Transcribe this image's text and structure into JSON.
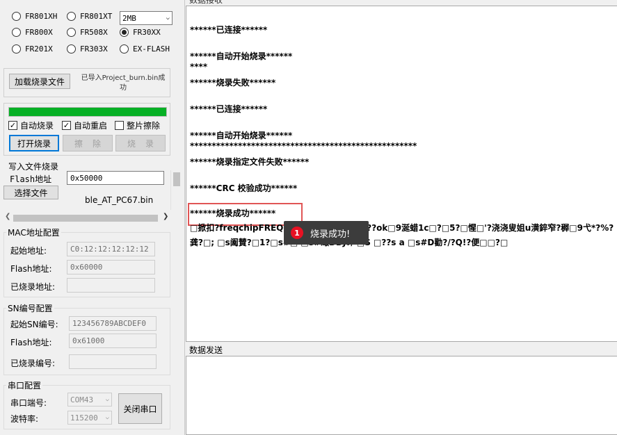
{
  "chip": {
    "options": [
      {
        "label": "FR801XH",
        "checked": false
      },
      {
        "label": "FR801XT",
        "checked": false
      },
      {
        "label": "FR800X",
        "checked": false
      },
      {
        "label": "FR508X",
        "checked": false
      },
      {
        "label": "FR30XX",
        "checked": true
      },
      {
        "label": "FR201X",
        "checked": false
      },
      {
        "label": "FR303X",
        "checked": false
      },
      {
        "label": "EX-FLASH",
        "checked": false
      }
    ],
    "flash_size": "2MB"
  },
  "load": {
    "button": "加载烧录文件",
    "status": "已导入Project_burn.bin成功"
  },
  "progress": 1.0,
  "options": {
    "auto_burn": "自动烧录",
    "auto_restart": "自动重启",
    "full_erase": "整片擦除"
  },
  "actions": {
    "open": "打开烧录",
    "erase": "擦除",
    "burn": "烧录"
  },
  "write_file": {
    "title": "写入文件烧录",
    "flash_addr_label": "Flash地址",
    "flash_addr": "0x50000",
    "select_button": "选择文件",
    "file_name": "ble_AT_PC67.bin"
  },
  "mac": {
    "title": "MAC地址配置",
    "start_label": "起始地址:",
    "start": "C0:12:12:12:12:12",
    "flash_label": "Flash地址:",
    "flash": "0x60000",
    "burned_label": "已烧录地址:",
    "burned": ""
  },
  "sn": {
    "title": "SN编号配置",
    "start_label": "起始SN编号:",
    "start": "123456789ABCDEF0",
    "flash_label": "Flash地址:",
    "flash": "0x61000",
    "burned_label": "已烧录编号:",
    "burned": ""
  },
  "serial": {
    "title": "串口配置",
    "port_label": "串口端号:",
    "port": "COM43",
    "baud_label": "波特率:",
    "baud": "115200",
    "close_button": "关闭串口"
  },
  "receive": {
    "title": "数据接收",
    "lines": [
      "******已连接******",
      "******自动开始烧录******",
      "****",
      "******烧录失败******",
      "******已连接******",
      "******自动开始烧录******",
      "****************************************************",
      "******烧录指定文件失败******",
      "******CRC 校验成功******",
      "******烧录成功******",
      "□掀扣?freqchipFREQC'  9?泽?ll?n?f?c编???ok□9涎蜡1c□?□5?□惺□'?浇浇叟姐u潢錊窄?稺□9弋*?%?",
      "龚?□;   □s阖賛?□1?□s#□   □s#瞰DDJ?/   □S   □??s a □s#D勸?/?Q!?便□□?□"
    ]
  },
  "toast": {
    "badge": "1",
    "text": "烧录成功!"
  },
  "send": {
    "title": "数据发送"
  },
  "colors": {
    "progress": "#06b025",
    "highlight": "#e05555",
    "toast_bg": "#3c3c3c",
    "badge": "#e81123"
  }
}
